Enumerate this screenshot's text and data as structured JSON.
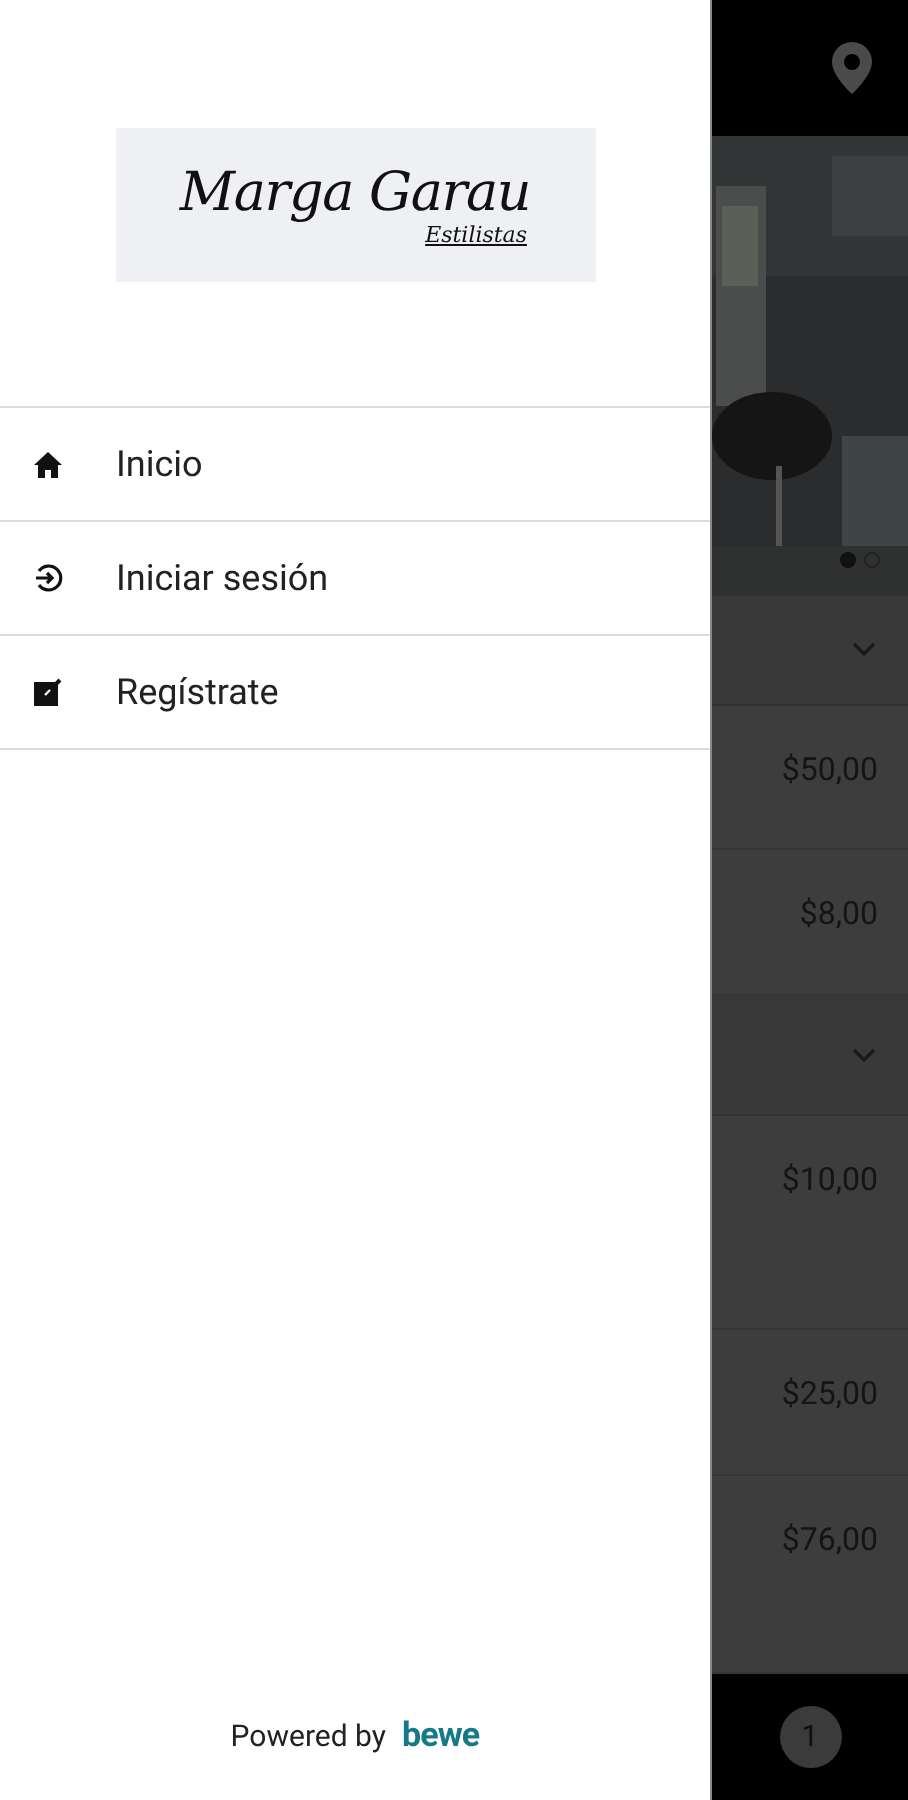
{
  "drawer": {
    "logo": {
      "name": "Marga Garau",
      "subtitle": "Estilistas"
    },
    "menu": [
      {
        "label": "Inicio",
        "kind": "home"
      },
      {
        "label": "Iniciar sesión",
        "kind": "login"
      },
      {
        "label": "Regístrate",
        "kind": "register"
      }
    ],
    "footer": {
      "powered_by": "Powered by",
      "brand": "bewe"
    }
  },
  "background": {
    "carousel_dots": [
      {
        "selected": true
      },
      {
        "selected": false
      }
    ],
    "rows": [
      {
        "kind": "chevron"
      },
      {
        "kind": "price",
        "price": "$50,00"
      },
      {
        "kind": "price",
        "price": "$8,00"
      },
      {
        "kind": "chevron"
      },
      {
        "kind": "price",
        "price": "$10,00"
      },
      {
        "kind": "price",
        "price": "$25,00"
      },
      {
        "kind": "price",
        "price": "$76,00"
      }
    ],
    "cart_badge": "1"
  }
}
